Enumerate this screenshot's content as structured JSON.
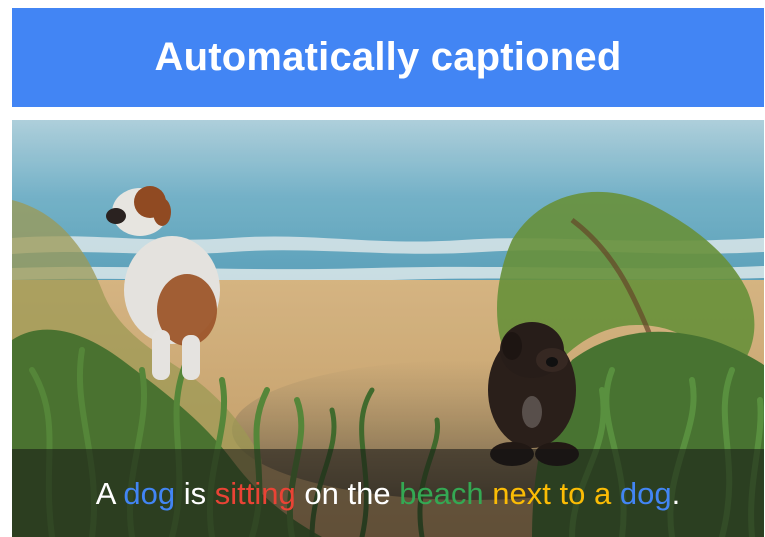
{
  "banner": {
    "title": "Automatically captioned",
    "background": "#4285f4"
  },
  "image": {
    "icon": "beach-photo-two-dogs",
    "caption": {
      "parts": [
        {
          "text": "A",
          "color": "#ffffff"
        },
        {
          "text": "dog",
          "color": "#4285f4"
        },
        {
          "text": "is",
          "color": "#ffffff"
        },
        {
          "text": "sitting",
          "color": "#ea4335"
        },
        {
          "text": "on the",
          "color": "#ffffff"
        },
        {
          "text": "beach",
          "color": "#34a853"
        },
        {
          "text": "next to a",
          "color": "#fbbc05"
        },
        {
          "text": "dog",
          "color": "#4285f4"
        },
        {
          "text": ".",
          "color": "#ffffff"
        }
      ]
    }
  }
}
